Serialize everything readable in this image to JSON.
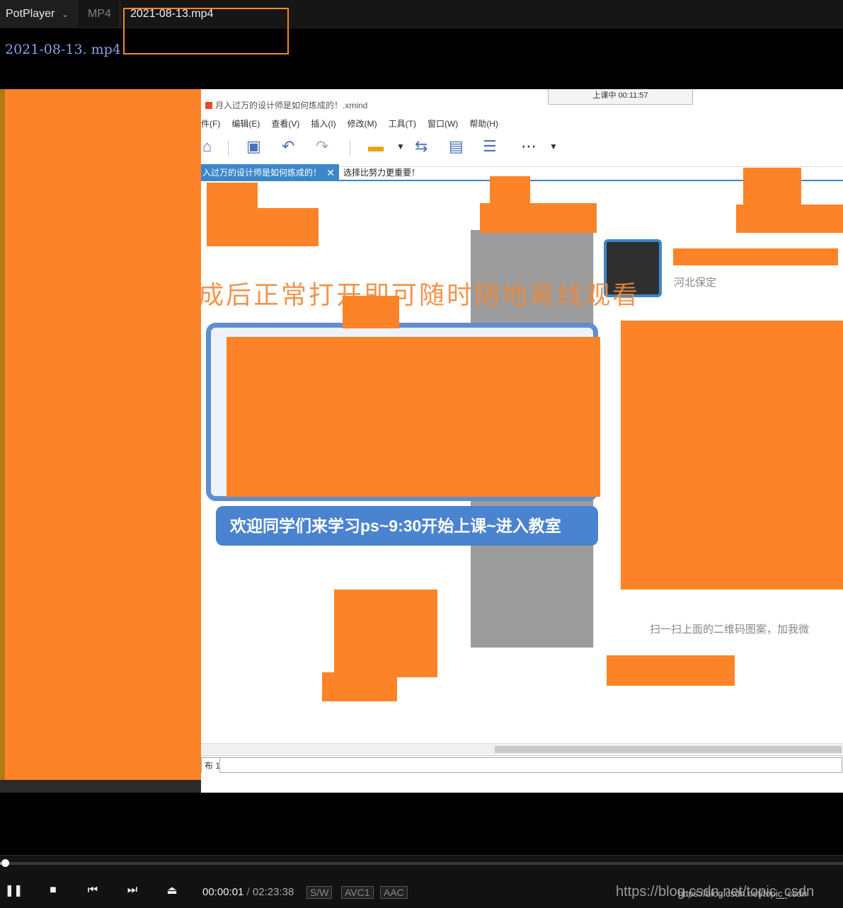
{
  "titlebar": {
    "app_name": "PotPlayer",
    "format": "MP4",
    "file_title": "2021-08-13.mp4"
  },
  "osd": {
    "filename": "2021-08-13. mp4"
  },
  "video": {
    "xmind_window_title": "月入过万的设计师是如何炼成的！.xmind",
    "class_timer": "上课中 00:11:57",
    "menu": [
      "件(F)",
      "编辑(E)",
      "查看(V)",
      "插入(I)",
      "修改(M)",
      "工具(T)",
      "窗口(W)",
      "帮助(H)"
    ],
    "tabs": [
      "入过万的设计师是如何炼成的！",
      "选择比努力更重要！"
    ],
    "overlay_text": "成后正常打开即可随时随地离线观看",
    "banner_text": "欢迎同学们来学习ps~9:30开始上课~进入教室",
    "avatar_name": "河北保定",
    "scan_text": "扫一扫上面的二维码图案，加我微",
    "sheet_label": "布 1"
  },
  "controls": {
    "current_time": "00:00:01",
    "separator": "/",
    "duration": "02:23:38",
    "badges": [
      "S/W",
      "AVC1",
      "AAC"
    ],
    "progress": 0.0001,
    "watermark_url": "https://blog.csdn.net/topic_csdn",
    "watermark_url_small": "https://blog.csdn.net/topic_csdn"
  },
  "colors": {
    "redaction": "#fd8328",
    "highlight_box": "#f1882c",
    "xmind_blue": "#3c87c9"
  }
}
